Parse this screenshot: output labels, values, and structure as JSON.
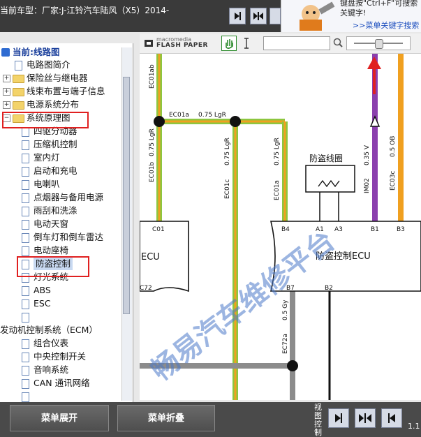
{
  "header": {
    "vehicle_label": "当前车型：厂家:J-江铃汽车陆风（X5）2014-",
    "search_tip": "键盘按\"Ctrl+F\"可搜索关键字!",
    "search_link": ">>菜单关键字搜索"
  },
  "tree": {
    "root_label": "当前:线路图",
    "items": [
      {
        "label": "电路图简介",
        "type": "doc",
        "indent": 0
      },
      {
        "label": "保险丝与继电器",
        "type": "folder",
        "indent": 0
      },
      {
        "label": "线束布置与端子信息",
        "type": "folder",
        "indent": 0
      },
      {
        "label": "电源系统分布",
        "type": "folder",
        "indent": 0
      },
      {
        "label": "系统原理图",
        "type": "folder-open",
        "indent": 0
      },
      {
        "label": "四驱分动器",
        "type": "doc",
        "indent": 1
      },
      {
        "label": "压缩机控制",
        "type": "doc",
        "indent": 1
      },
      {
        "label": "室内灯",
        "type": "doc",
        "indent": 1
      },
      {
        "label": "启动和充电",
        "type": "doc",
        "indent": 1
      },
      {
        "label": "电喇叭",
        "type": "doc",
        "indent": 1
      },
      {
        "label": "点烟器与备用电源",
        "type": "doc",
        "indent": 1
      },
      {
        "label": "雨刮和洗涤",
        "type": "doc",
        "indent": 1
      },
      {
        "label": "电动天窗",
        "type": "doc",
        "indent": 1
      },
      {
        "label": "倒车灯和倒车雷达",
        "type": "doc",
        "indent": 1
      },
      {
        "label": "电动座椅",
        "type": "doc",
        "indent": 1
      },
      {
        "label": "防盗控制",
        "type": "doc",
        "indent": 1,
        "selected": true
      },
      {
        "label": "灯光系统",
        "type": "doc",
        "indent": 1
      },
      {
        "label": "ABS",
        "type": "doc",
        "indent": 1
      },
      {
        "label": "ESC",
        "type": "doc",
        "indent": 1
      },
      {
        "label": "",
        "type": "doc",
        "indent": 1
      },
      {
        "label": "发动机控制系统（ECM）",
        "type": "none",
        "indent": -1
      },
      {
        "label": "组合仪表",
        "type": "doc",
        "indent": 1
      },
      {
        "label": "中央控制开关",
        "type": "doc",
        "indent": 1
      },
      {
        "label": "音响系统",
        "type": "doc",
        "indent": 1
      },
      {
        "label": "CAN 通讯网络",
        "type": "doc",
        "indent": 1
      },
      {
        "label": "",
        "type": "doc",
        "indent": 1
      }
    ]
  },
  "viewer": {
    "brand_top": "macromedia",
    "brand_bottom": "FLASH PAPER"
  },
  "diagram": {
    "wire_labels": [
      "EC01ab",
      "EC01a",
      "0.75 LgR",
      "EC01b",
      "0.75 LgR",
      "EC01c",
      "0.75 LgR",
      "EC01a",
      "0.75 LgR",
      "IM02",
      "0.35 V",
      "EC03c",
      "0.5 OB",
      "EC72a",
      "0.5 Gy"
    ],
    "theft_coil": "防盗线圈",
    "ecu_left": "ECU",
    "ecu_right": "防盗控制ECU",
    "pins_left": [
      "C01",
      "C72"
    ],
    "pins_right": [
      "B4",
      "A1",
      "A3",
      "B1",
      "B3",
      "B7",
      "B2"
    ],
    "watermark": "畅易汽车维修平台"
  },
  "footer": {
    "expand_label": "菜单展开",
    "collapse_label": "菜单折叠",
    "view_label": "视图控制",
    "version": "1.1"
  },
  "colors": {
    "accent_red": "#e02020",
    "wire_green": "#8dc63f",
    "wire_orange": "#f0a020",
    "wire_purple": "#8b3fae",
    "wire_gray": "#8c8c8c",
    "watermark": "#4a78c8"
  }
}
